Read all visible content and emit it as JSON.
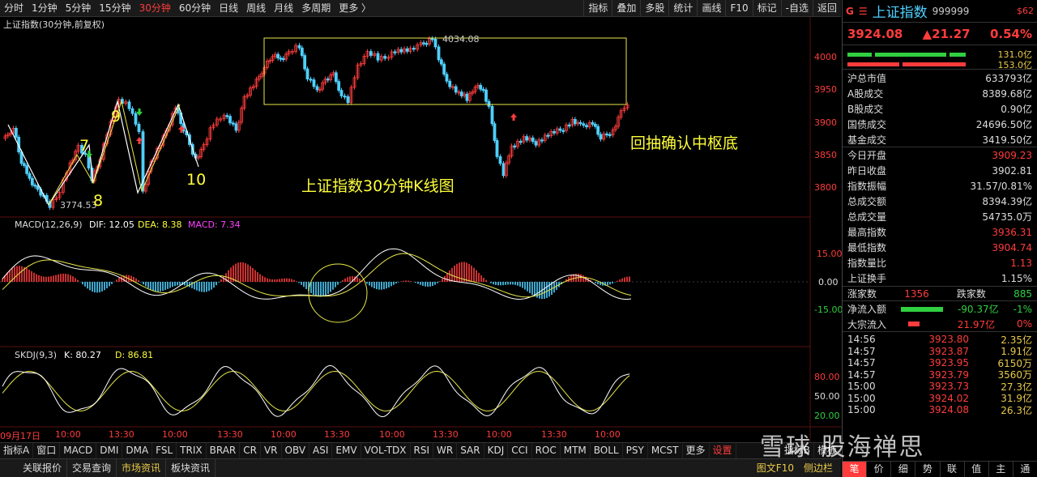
{
  "toolbar": {
    "timeframes": [
      "分时",
      "1分钟",
      "5分钟",
      "15分钟",
      "30分钟",
      "60分钟",
      "日线",
      "周线",
      "月线",
      "多周期",
      "更多 〉"
    ],
    "active_timeframe": "30分钟",
    "right_buttons": [
      "指标",
      "叠加",
      "多股",
      "统计",
      "画线",
      "F10",
      "标记",
      "-自选",
      "返回"
    ]
  },
  "chart": {
    "title": "上证指数(30分钟,前复权)",
    "annotation_main": "上证指数30分钟K线图",
    "annotation_right": "回抽确认中枢底",
    "high_label": "4034.08",
    "low_label": "3774.53",
    "wave_labels": [
      "7",
      "8",
      "9",
      "10"
    ],
    "price_ticks": [
      "4000",
      "3950",
      "3900",
      "3850",
      "3800"
    ],
    "macd": {
      "title": "MACD(12,26,9)",
      "dif": "DIF: 12.05",
      "dea": "DEA: 8.38",
      "macd": "MACD: 7.34",
      "ticks": [
        "15.00",
        "0.00",
        "-15.00"
      ]
    },
    "kdj": {
      "title": "SKDJ(9,3)",
      "k": "K: 80.27",
      "d": "D: 86.81",
      "ticks": [
        "80.00",
        "50.00",
        "20.00"
      ]
    },
    "time_axis": [
      "09月17日",
      "10:00",
      "13:30",
      "10:00",
      "13:30",
      "10:00",
      "13:30",
      "10:00",
      "13:30",
      "10:00",
      "13:30",
      "10:00"
    ],
    "colors": {
      "up": "#ff3c3c",
      "down": "#4fd0ff",
      "dif": "#ffffff",
      "dea": "#e8e84a",
      "box": "#e8e84a",
      "k": "#ffffff",
      "d": "#e8e84a"
    }
  },
  "indicators": [
    "指标A",
    "窗口",
    "MACD",
    "DMI",
    "DMA",
    "FSL",
    "TRIX",
    "BRAR",
    "CR",
    "VR",
    "OBV",
    "ASI",
    "EMV",
    "VOL-TDX",
    "RSI",
    "WR",
    "SAR",
    "KDJ",
    "CCI",
    "ROC",
    "MTM",
    "BOLL",
    "PSY",
    "MCST",
    "更多",
    "设置"
  ],
  "indicators_right": [
    "指标B",
    "模板"
  ],
  "status": {
    "items": [
      "关联报价",
      "交易查询",
      "市场资讯",
      "板块资讯"
    ],
    "right": [
      "图文F10",
      "侧边栏"
    ]
  },
  "panel": {
    "g": "G",
    "menu": "☰",
    "name": "上证指数",
    "code": "999999",
    "s62": "$62",
    "price": "3924.08",
    "change": "▲21.27",
    "pct": "0.54%",
    "bar_labels": [
      "131.0亿",
      "153.0亿"
    ],
    "stats": [
      {
        "k": "沪总市值",
        "v": "633793亿",
        "c": ""
      },
      {
        "k": "A股成交",
        "v": "8389.68亿",
        "c": ""
      },
      {
        "k": "B股成交",
        "v": "0.90亿",
        "c": ""
      },
      {
        "k": "国债成交",
        "v": "24696.50亿",
        "c": ""
      },
      {
        "k": "基金成交",
        "v": "3419.50亿",
        "c": ""
      },
      {
        "k": "今日开盘",
        "v": "3909.23",
        "c": "red"
      },
      {
        "k": "昨日收盘",
        "v": "3902.81",
        "c": ""
      },
      {
        "k": "指数振幅",
        "v": "31.57/0.81%",
        "c": ""
      },
      {
        "k": "总成交额",
        "v": "8394.39亿",
        "c": ""
      },
      {
        "k": "总成交量",
        "v": "54735.0万",
        "c": ""
      },
      {
        "k": "最高指数",
        "v": "3936.31",
        "c": "red"
      },
      {
        "k": "最低指数",
        "v": "3904.74",
        "c": "red"
      },
      {
        "k": "指数量比",
        "v": "1.13",
        "c": "red"
      },
      {
        "k": "上证换手",
        "v": "1.15%",
        "c": ""
      }
    ],
    "updown": {
      "up_label": "涨家数",
      "up": "1356",
      "down_label": "跌家数",
      "down": "885"
    },
    "flows": [
      {
        "k": "净流入额",
        "v": "-90.37亿",
        "p": "-1%"
      },
      {
        "k": "大宗流入",
        "v": "21.97亿",
        "p": "0%"
      }
    ],
    "ticks": [
      {
        "t": "14:56",
        "p": "3923.80",
        "v": "2.35亿"
      },
      {
        "t": "14:57",
        "p": "3923.87",
        "v": "1.91亿"
      },
      {
        "t": "14:57",
        "p": "3923.95",
        "v": "6150万"
      },
      {
        "t": "14:57",
        "p": "3923.79",
        "v": "3560万"
      },
      {
        "t": "15:00",
        "p": "3923.73",
        "v": "27.3亿"
      },
      {
        "t": "15:00",
        "p": "3924.02",
        "v": "31.9亿"
      },
      {
        "t": "15:00",
        "p": "3924.08",
        "v": "26.3亿"
      }
    ],
    "tabs": [
      "笔",
      "价",
      "细",
      "势",
      "联",
      "值",
      "主",
      "通"
    ]
  },
  "watermark": "雪球  股海禅思"
}
